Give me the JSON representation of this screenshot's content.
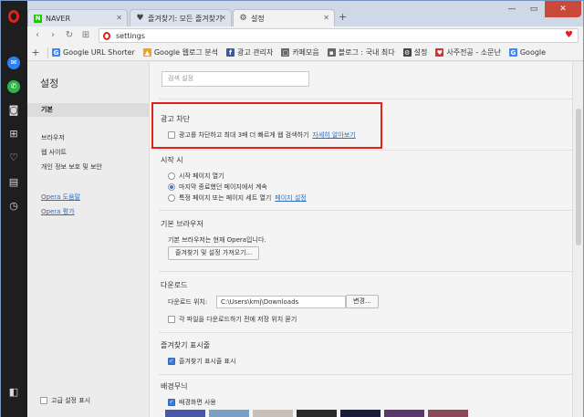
{
  "tabs": [
    {
      "label": "NAVER",
      "icon": "naver-icon"
    },
    {
      "label": "즐겨찾기: 모든 즐겨찾기",
      "icon": "heart-icon"
    },
    {
      "label": "설정",
      "icon": "gear-icon"
    }
  ],
  "address": {
    "url": "settings"
  },
  "bookmarks": [
    {
      "label": "Google URL Shorter",
      "color": "#4285f4",
      "glyph": "G"
    },
    {
      "label": "Google 웹로그 분석",
      "color": "#f4a020",
      "glyph": "▲"
    },
    {
      "label": "광고 관리자",
      "color": "#3b5998",
      "glyph": "f"
    },
    {
      "label": "카페모음",
      "color": "#666666",
      "glyph": "▢"
    },
    {
      "label": "블로그 : 국내 최다",
      "color": "#666666",
      "glyph": "▪"
    },
    {
      "label": "설정",
      "color": "#444444",
      "glyph": "⚙"
    },
    {
      "label": "사주전공 - 소문난",
      "color": "#d9302a",
      "glyph": "♥"
    },
    {
      "label": "Google",
      "color": "#4285f4",
      "glyph": "G"
    }
  ],
  "sidebar": {
    "title": "설정",
    "nav": [
      "기본",
      "브라우저",
      "웹 사이트",
      "개인 정보 보호 및 보안"
    ],
    "links": [
      "Opera 도움말",
      "Opera 평가"
    ],
    "advanced": "고급 설정 표시"
  },
  "search": {
    "placeholder": "검색 설정"
  },
  "adblock": {
    "title": "광고 차단",
    "checkbox": "광고를 차단하고 최대 3배 더 빠르게 웹 검색하기",
    "link": "자세히 알아보기"
  },
  "startup": {
    "title": "시작 시",
    "options": [
      "시작 페이지 열기",
      "마지막 종료했던 페이지에서 계속",
      "특정 페이지 또는 페이지 세트 열기"
    ],
    "set_pages_link": "페이지 설정",
    "selected": 1
  },
  "default_browser": {
    "title": "기본 브라우저",
    "text": "기본 브라우저는 현재 Opera입니다.",
    "import_button": "즐겨찾기 및 설정 가져오기..."
  },
  "downloads": {
    "title": "다운로드",
    "location_label": "다운로드 위치:",
    "path": "C:\\Users\\kmj\\Downloads",
    "change_button": "변경...",
    "ask_checkbox": "각 파일을 다운로드하기 전에 저장 위치 묻기"
  },
  "bookmarks_bar": {
    "title": "즐겨찾기 표시줄",
    "checkbox": "즐겨찾기 표시줄 표시"
  },
  "wallpaper": {
    "title": "배경무늬",
    "checkbox": "배경화면 사용",
    "swatch_colors": [
      "#4a56a8",
      "#7aa0c4",
      "#c8c0b8",
      "#2a2a2a",
      "#1a1a3a",
      "#5a3a6a",
      "#8a4a5a"
    ]
  },
  "colors": {
    "accent": "#e0221b",
    "link": "#2d6cc0",
    "checkbox": "#3a7bd5"
  }
}
